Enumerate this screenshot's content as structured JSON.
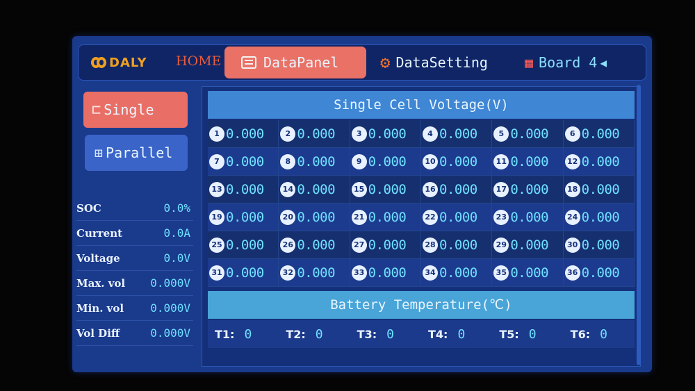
{
  "header": {
    "logo_text": "DALY",
    "home_label": "HOME",
    "tabs": [
      {
        "label": "DataPanel"
      },
      {
        "label": "DataSetting"
      },
      {
        "label": "Board 4"
      }
    ]
  },
  "sidebar": {
    "single_label": "Single",
    "parallel_label": "Parallel",
    "stats": [
      {
        "label": "SOC",
        "value": "0.0%"
      },
      {
        "label": "Current",
        "value": "0.0A"
      },
      {
        "label": "Voltage",
        "value": "0.0V"
      },
      {
        "label": "Max. vol",
        "value": "0.000V"
      },
      {
        "label": "Min. vol",
        "value": "0.000V"
      },
      {
        "label": "Vol Diff",
        "value": "0.000V"
      }
    ]
  },
  "cells": {
    "title": "Single Cell Voltage(V)",
    "values": [
      "0.000",
      "0.000",
      "0.000",
      "0.000",
      "0.000",
      "0.000",
      "0.000",
      "0.000",
      "0.000",
      "0.000",
      "0.000",
      "0.000",
      "0.000",
      "0.000",
      "0.000",
      "0.000",
      "0.000",
      "0.000",
      "0.000",
      "0.000",
      "0.000",
      "0.000",
      "0.000",
      "0.000",
      "0.000",
      "0.000",
      "0.000",
      "0.000",
      "0.000",
      "0.000",
      "0.000",
      "0.000",
      "0.000",
      "0.000",
      "0.000",
      "0.000"
    ]
  },
  "temperature": {
    "title": "Battery Temperature(℃)",
    "sensors": [
      {
        "label": "T1:",
        "value": "0"
      },
      {
        "label": "T2:",
        "value": "0"
      },
      {
        "label": "T3:",
        "value": "0"
      },
      {
        "label": "T4:",
        "value": "0"
      },
      {
        "label": "T5:",
        "value": "0"
      },
      {
        "label": "T6:",
        "value": "0"
      }
    ]
  },
  "colors": {
    "screen_bg": "#1a3a8c",
    "active_tab": "#ea7166",
    "value_text": "#6fe0ff",
    "logo": "#f0a020",
    "home": "#e85c3c"
  }
}
